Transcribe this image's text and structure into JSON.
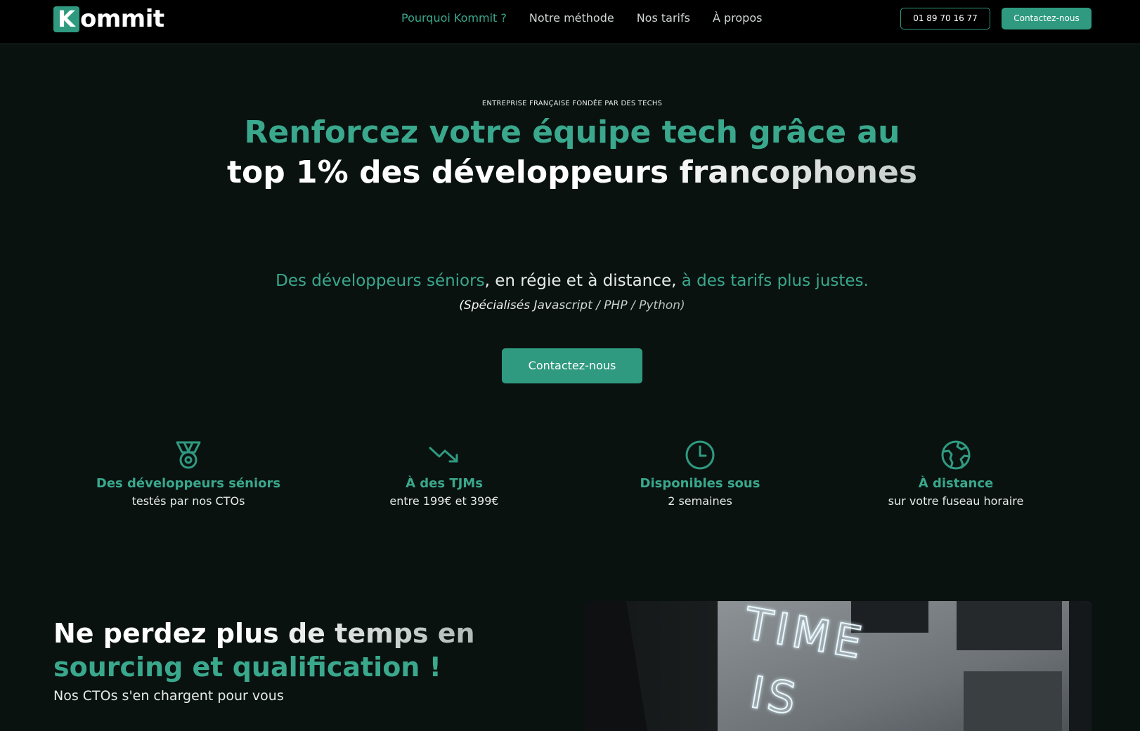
{
  "header": {
    "logo_letter": "K",
    "logo_rest": "ommit",
    "nav": [
      {
        "label": "Pourquoi Kommit ?",
        "active": true
      },
      {
        "label": "Notre méthode",
        "active": false
      },
      {
        "label": "Nos tarifs",
        "active": false
      },
      {
        "label": "À propos",
        "active": false
      }
    ],
    "phone_label": "01 89 70 16 77",
    "contact_label": "Contactez-nous"
  },
  "hero": {
    "eyebrow": "ENTREPRISE FRANÇAISE FONDÉE PAR DES TECHS",
    "title_line1": "Renforcez votre équipe tech grâce au",
    "title_line2": "top 1% des développeurs francophones",
    "subtitle_part1": "Des développeurs séniors",
    "subtitle_part2": ", en régie et à distance, ",
    "subtitle_part3": "à des tarifs plus justes.",
    "specialties": "(Spécialisés Javascript / PHP / Python)",
    "cta_label": "Contactez-nous"
  },
  "features": [
    {
      "icon": "medal-icon",
      "title": "Des développeurs séniors",
      "subtitle": "testés par nos CTOs"
    },
    {
      "icon": "trending-down-icon",
      "title": "À des TJMs",
      "subtitle": "entre 199€ et 399€"
    },
    {
      "icon": "clock-icon",
      "title": "Disponibles sous",
      "subtitle": "2 semaines"
    },
    {
      "icon": "globe-icon",
      "title": "À distance",
      "subtitle": "sur votre fuseau horaire"
    }
  ],
  "section2": {
    "title_part1": "Ne perdez plus de temps en ",
    "title_part2": "sourcing et qualification !",
    "subtitle": "Nos CTOs s'en chargent pour vous",
    "image_neon_text": "TIME IS"
  },
  "colors": {
    "accent": "#2f9a80",
    "accent_text": "#3aa88c",
    "background": "#0a1210",
    "header_bg": "#000000"
  }
}
